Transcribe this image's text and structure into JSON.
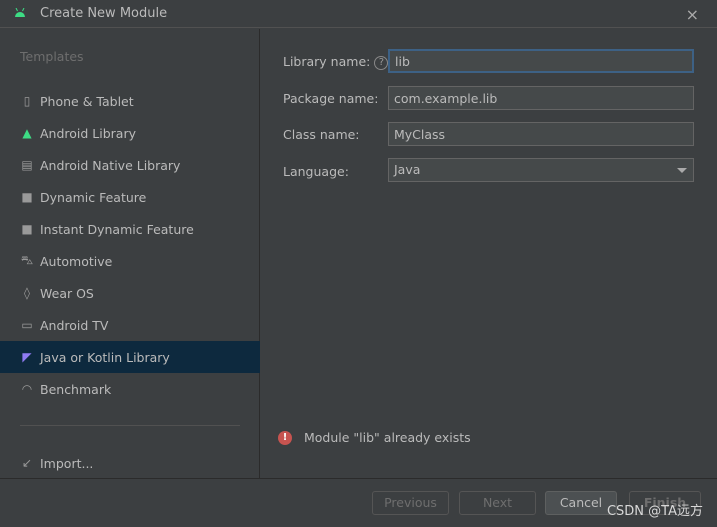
{
  "window": {
    "title": "Create New Module",
    "close_icon": "×"
  },
  "sidebar": {
    "header": "Templates",
    "items": [
      {
        "label": "Phone & Tablet",
        "icon": "phone-tablet-icon",
        "glyph": "▯"
      },
      {
        "label": "Android Library",
        "icon": "android-icon",
        "glyph": "▲"
      },
      {
        "label": "Android Native Library",
        "icon": "chip-icon",
        "glyph": "▤"
      },
      {
        "label": "Dynamic Feature",
        "icon": "folder-module-icon",
        "glyph": "■"
      },
      {
        "label": "Instant Dynamic Feature",
        "icon": "folder-instant-icon",
        "glyph": "■"
      },
      {
        "label": "Automotive",
        "icon": "car-icon",
        "glyph": "⛍"
      },
      {
        "label": "Wear OS",
        "icon": "watch-icon",
        "glyph": "◊"
      },
      {
        "label": "Android TV",
        "icon": "tv-icon",
        "glyph": "▭"
      },
      {
        "label": "Java or Kotlin Library",
        "icon": "kotlin-icon",
        "glyph": "◤"
      },
      {
        "label": "Benchmark",
        "icon": "gauge-icon",
        "glyph": "◠"
      }
    ],
    "import": {
      "label": "Import...",
      "icon": "import-icon",
      "glyph": "↙"
    },
    "selected": "Java or Kotlin Library"
  },
  "form": {
    "library_name": {
      "label": "Library name:",
      "value": "lib",
      "help": "?"
    },
    "package_name": {
      "label": "Package name:",
      "value": "com.example.lib"
    },
    "class_name": {
      "label": "Class name:",
      "value": "MyClass"
    },
    "language": {
      "label": "Language:",
      "value": "Java"
    }
  },
  "error": {
    "icon": "!",
    "message": "Module \"lib\" already exists",
    "color": "#c75450"
  },
  "footer": {
    "previous": "Previous",
    "next": "Next",
    "cancel": "Cancel",
    "finish": "Finish"
  },
  "watermark": "CSDN @TA远方"
}
